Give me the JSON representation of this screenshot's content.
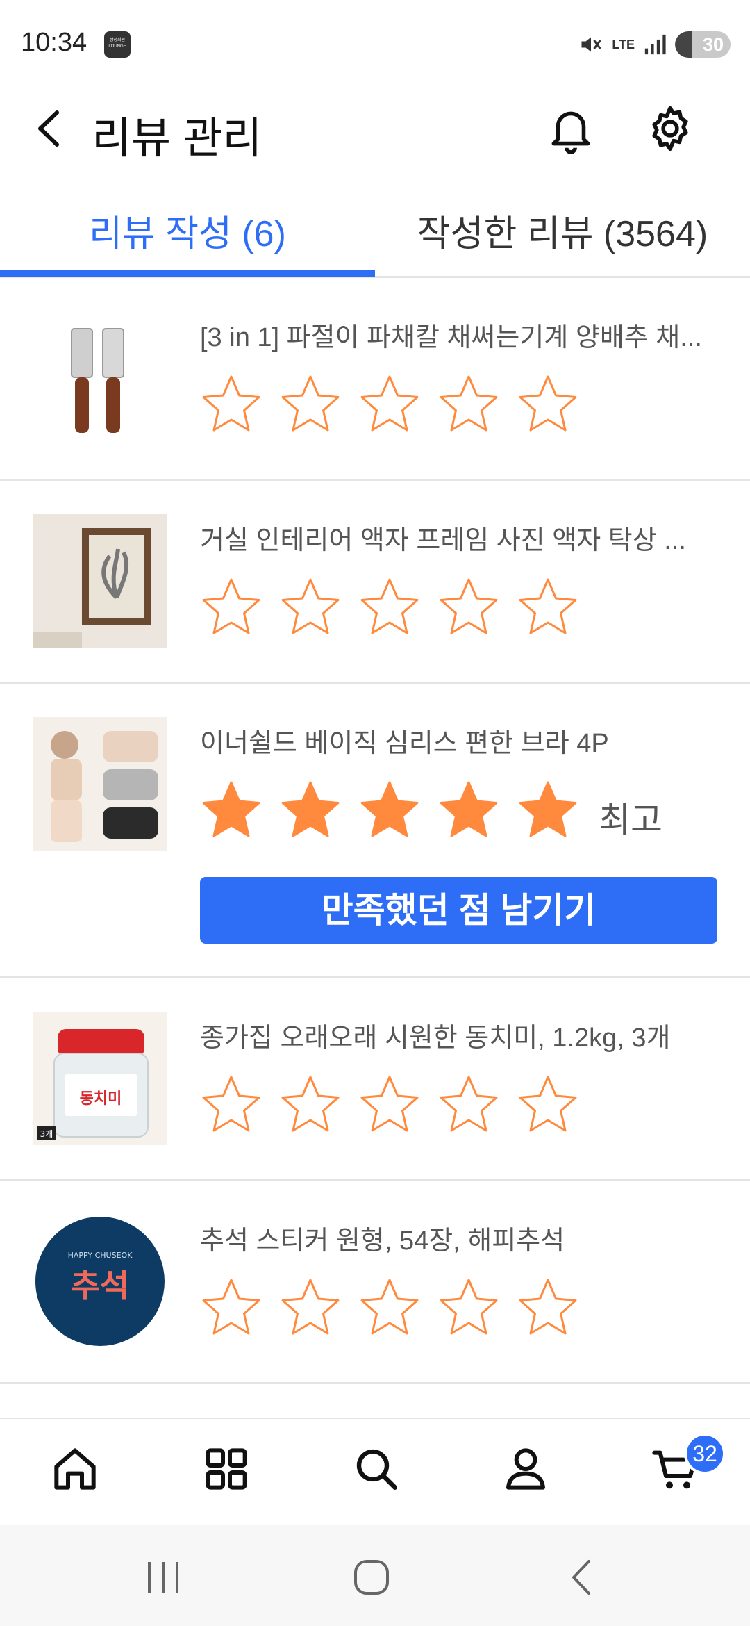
{
  "status_bar": {
    "time": "10:34",
    "lounge_badge": "삼성회원 LOUNGE",
    "network": "LTE",
    "battery": "30",
    "battery_level": 0.3
  },
  "header": {
    "title": "리뷰 관리",
    "icons": {
      "back": "chevron-left-icon",
      "bell": "bell-icon",
      "settings": "gear-icon"
    }
  },
  "tabs": [
    {
      "label": "리뷰 작성 (6)",
      "active": true
    },
    {
      "label": "작성한 리뷰 (3564)",
      "active": false
    }
  ],
  "items": [
    {
      "title": "[3 in 1] 파절이 파채칼 채써는기계 양배추 채...",
      "rating": 0,
      "max_rating": 5,
      "rating_label": "",
      "action_label": ""
    },
    {
      "title": "거실 인테리어 액자 프레임 사진 액자 탁상 ...",
      "rating": 0,
      "max_rating": 5,
      "rating_label": "",
      "action_label": ""
    },
    {
      "title": "이너쉴드 베이직 심리스 편한 브라 4P",
      "rating": 5,
      "max_rating": 5,
      "rating_label": "최고",
      "action_label": "만족했던 점 남기기"
    },
    {
      "title": "종가집 오래오래 시원한 동치미, 1.2kg, 3개",
      "rating": 0,
      "max_rating": 5,
      "rating_label": "",
      "action_label": "",
      "thumb_text": "동치미",
      "thumb_badge": "3개"
    },
    {
      "title": "추석 스티커 원형, 54장, 해피추석",
      "rating": 0,
      "max_rating": 5,
      "rating_label": "",
      "action_label": "",
      "thumb_text": "추석",
      "thumb_subtext": "HAPPY CHUSEOK"
    }
  ],
  "bottom_nav": {
    "items": [
      "home-icon",
      "grid-icon",
      "search-icon",
      "person-icon",
      "cart-icon"
    ],
    "cart_badge": "32"
  },
  "colors": {
    "accent": "#2e6ef7",
    "star": "#ff8a3d",
    "divider": "#e4e4e4"
  }
}
